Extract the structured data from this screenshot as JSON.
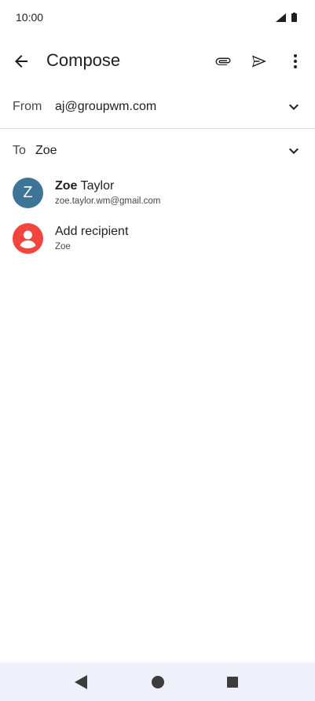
{
  "status": {
    "time": "10:00"
  },
  "appbar": {
    "title": "Compose",
    "icons": [
      "back-icon",
      "attach-icon",
      "send-icon",
      "more-vert-icon"
    ]
  },
  "from": {
    "label": "From",
    "value": "aj@groupwm.com"
  },
  "to": {
    "label": "To",
    "value": "Zoe"
  },
  "suggestions": [
    {
      "avatar_letter": "Z",
      "name_bold": "Zoe",
      "name_rest": " Taylor",
      "subtitle": "zoe.taylor.wm@gmail.com",
      "avatar_color": "#3e7596"
    },
    {
      "name": "Add recipient",
      "subtitle": "Zoe",
      "avatar_color": "#f2453d",
      "icon": "person-icon"
    }
  ],
  "navbar": {
    "icons": [
      "nav-back-icon",
      "nav-home-icon",
      "nav-recents-icon"
    ]
  },
  "colors": {
    "navbar_bg": "#eef1f9",
    "divider": "#e0e0e0",
    "text": "#1f1f1f",
    "secondary_text": "#444746"
  }
}
